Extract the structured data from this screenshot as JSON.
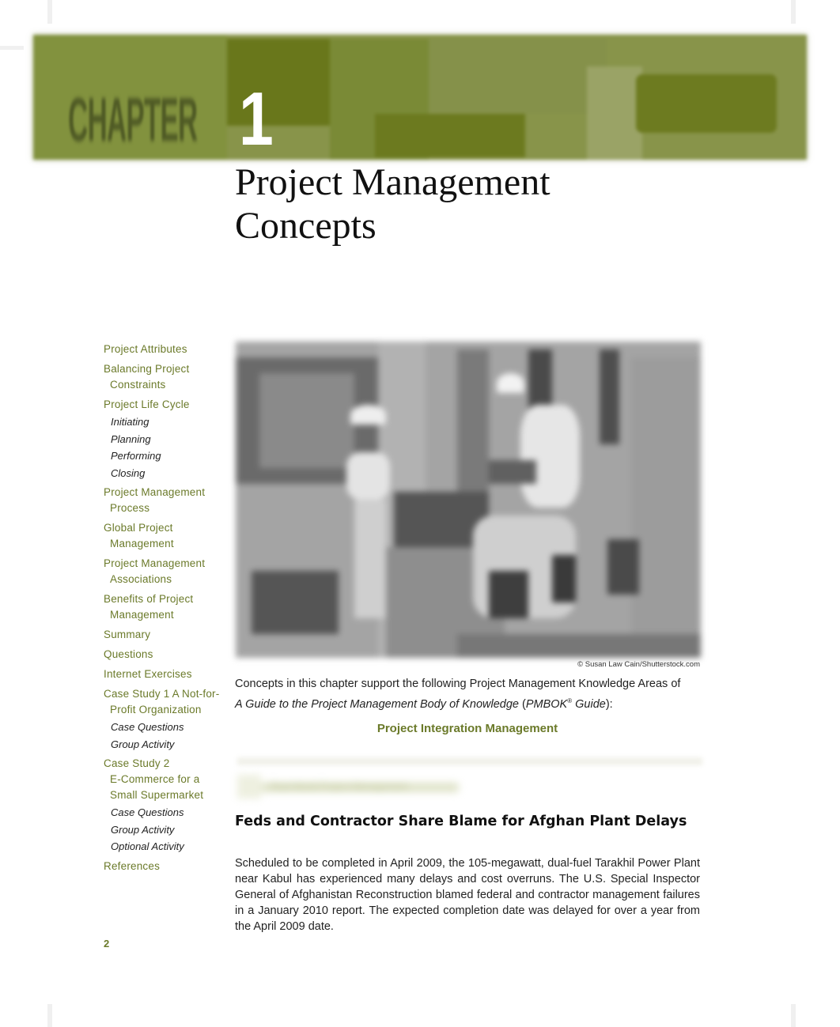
{
  "chapter": {
    "label": "CHAPTER",
    "number": "1",
    "title_line1": "Project Management",
    "title_line2": "Concepts",
    "banner_colors": {
      "base": "#88944a",
      "dark": "#69771b",
      "light": "#9aa366",
      "chapter_word": "#4f5a25"
    }
  },
  "toc": {
    "accent_color": "#6b7a2a",
    "items": [
      {
        "label": "Project Attributes"
      },
      {
        "label": "Balancing Project",
        "continuation": "Constraints"
      },
      {
        "label": "Project Life Cycle",
        "subs": [
          "Initiating",
          "Planning",
          "Performing",
          "Closing"
        ]
      },
      {
        "label": "Project Management",
        "continuation": "Process"
      },
      {
        "label": "Global Project",
        "continuation": "Management"
      },
      {
        "label": "Project Management",
        "continuation": "Associations"
      },
      {
        "label": "Benefits of Project",
        "continuation": "Management"
      },
      {
        "label": "Summary"
      },
      {
        "label": "Questions"
      },
      {
        "label": "Internet Exercises"
      },
      {
        "label": "Case Study 1 A Not-for-",
        "continuation": "Profit Organization",
        "subs": [
          "Case Questions",
          "Group Activity"
        ]
      },
      {
        "label": "Case Study 2",
        "continuation": "E-Commerce for a",
        "continuation2": "Small Supermarket",
        "subs": [
          "Case Questions",
          "Group Activity",
          "Optional Activity"
        ]
      },
      {
        "label": "References"
      }
    ]
  },
  "photo": {
    "description": "Two workers in hard hats at a construction site (grayscale photo)",
    "credit": "© Susan Law Cain/Shutterstock.com"
  },
  "intro": {
    "line1": "Concepts in this chapter support the following Project Management Knowledge Areas of",
    "line2_italic": "A Guide to the Project Management Body of Knowledge",
    "line2_paren_open": " (",
    "line2_pmbok": "PMBOK",
    "line2_reg": "®",
    "line2_guide": " Guide",
    "line2_end": "):",
    "knowledge_area": "Project Integration Management"
  },
  "feature": {
    "label": "Real World Project Management"
  },
  "article": {
    "headline": "Feds and Contractor Share Blame for Afghan Plant Delays",
    "body": "Scheduled to be completed in April 2009, the 105-megawatt, dual-fuel Tarakhil Power Plant near Kabul has experienced many delays and cost overruns. The U.S. Special Inspector General of Afghanistan Reconstruction blamed federal and con­tractor management failures in a January 2010 report. The expected completion date was delayed for over a year from the April 2009 date."
  },
  "page": {
    "number": "2"
  }
}
